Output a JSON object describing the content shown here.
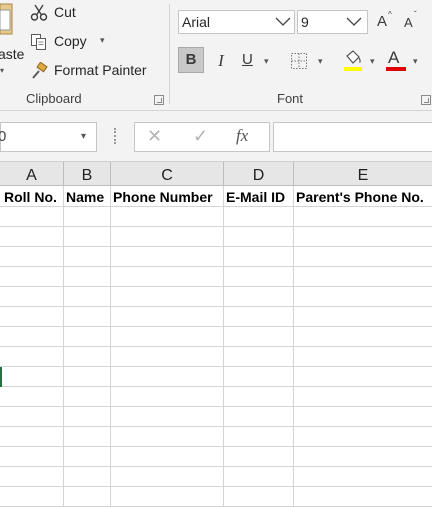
{
  "clipboard": {
    "cut_label": "Cut",
    "copy_label": "Copy",
    "paste_label": "Paste",
    "paste_label_visible": "aste",
    "format_painter_label": "Format Painter",
    "group_label": "Clipboard"
  },
  "font": {
    "family": "Arial",
    "size": "9",
    "group_label": "Font",
    "increase_size_label": "A",
    "decrease_size_label": "A",
    "bold_label": "B",
    "italic_label": "I",
    "underline_label": "U",
    "font_color_label": "A",
    "highlight_color": "#ffff00",
    "font_color": "#e00000"
  },
  "formula_bar": {
    "name_box": "0",
    "fx_label": "fx",
    "cancel_symbol": "✕",
    "enter_symbol": "✓",
    "formula_value": ""
  },
  "grid": {
    "columns": [
      "A",
      "B",
      "C",
      "D",
      "E"
    ],
    "header_row": [
      "Roll No.",
      "Name",
      "Phone Number",
      "E-Mail ID",
      "Parent's Phone No."
    ]
  }
}
